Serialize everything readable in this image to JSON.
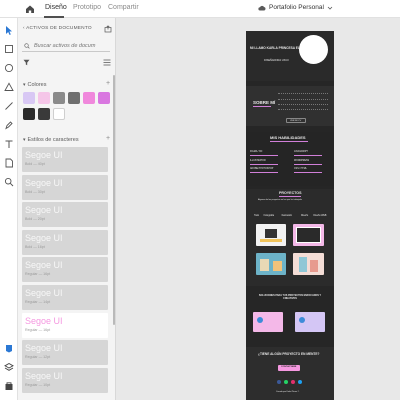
{
  "topbar": {
    "tabs": [
      {
        "label": "Diseño",
        "active": true
      },
      {
        "label": "Prototipo",
        "active": false
      },
      {
        "label": "Compartir",
        "active": false
      }
    ],
    "document_title": "Portafolio Personal"
  },
  "tools": [
    "select-arrow-icon",
    "rectangle-icon",
    "ellipse-icon",
    "triangle-icon",
    "line-icon",
    "pen-icon",
    "text-icon",
    "artboard-icon",
    "zoom-icon",
    "plugins-icon",
    "layers-icon",
    "assets-icon"
  ],
  "assets_panel": {
    "heading": "ACTIVOS DE DOCUMENTO",
    "search_placeholder": "Buscar activos de docum",
    "colors_heading": "Colores",
    "colors": [
      "#d8c8f4",
      "#f5c6e8",
      "#8a8a8a",
      "#6f6f6f",
      "#f088dc",
      "#d977e0",
      "#2b2b2b",
      "#3a3a3a",
      "#ffffff"
    ],
    "char_styles_heading": "Estilos de caracteres",
    "char_styles": [
      {
        "name": "Segoe UI",
        "meta": "Bold — 40pt",
        "selected": false
      },
      {
        "name": "Segoe UI",
        "meta": "Bold — 30pt",
        "selected": false
      },
      {
        "name": "Segoe UI",
        "meta": "Bold — 20pt",
        "selected": false
      },
      {
        "name": "Segoe UI",
        "meta": "Bold — 16pt",
        "selected": false
      },
      {
        "name": "Segoe UI",
        "meta": "Regular — 16pt",
        "selected": false
      },
      {
        "name": "Segoe UI",
        "meta": "Regular — 14pt",
        "selected": false
      },
      {
        "name": "Segoe UI",
        "meta": "Regular — 16pt",
        "selected": true
      },
      {
        "name": "Segoe UI",
        "meta": "Regular — 12pt",
        "selected": false
      },
      {
        "name": "Segoe UI",
        "meta": "Regular — 10pt",
        "selected": false
      }
    ]
  },
  "artboard": {
    "hero_title": "MI LLAMO KARLA PRINCESA ELVIRA PÉREZ",
    "hero_subtitle": "DISEÑADORA UX/UI",
    "about_heading": "SOBRE MÍ",
    "about_text_1": "Soy una apasionada de la interacción y la tecnología...",
    "about_text_2": "Me encanta aprender cosas nuevas cada día...",
    "cv_button": "VER MI CV",
    "skills_heading": "MIS HABILIDADES",
    "skills_left": [
      "FIGMA / XD",
      "ILLUSTRATOR",
      "ADOBE PHOTOSHOP"
    ],
    "skills_right": [
      "JAVASCRIPT",
      "WORDPRESS",
      "CSS / HTML"
    ],
    "projects_heading": "PROYECTOS",
    "projects_intro": "Algunos de los proyectos en los que he trabajado",
    "project_filters": [
      "Todo",
      "Fotografía",
      "Ilustración",
      "Diseño",
      "Diseño WEB"
    ],
    "solutions_heading": "SOLUCIONES PARA TUS PROYECTOS ENFOCADOS Y CREATIVOS",
    "cta_heading": "¿TIENE ALGÚN PROYECTO EN MENTE?",
    "cta_button": "CONTÁCTAME",
    "footer": "Creado por Karla Pérez ©"
  }
}
